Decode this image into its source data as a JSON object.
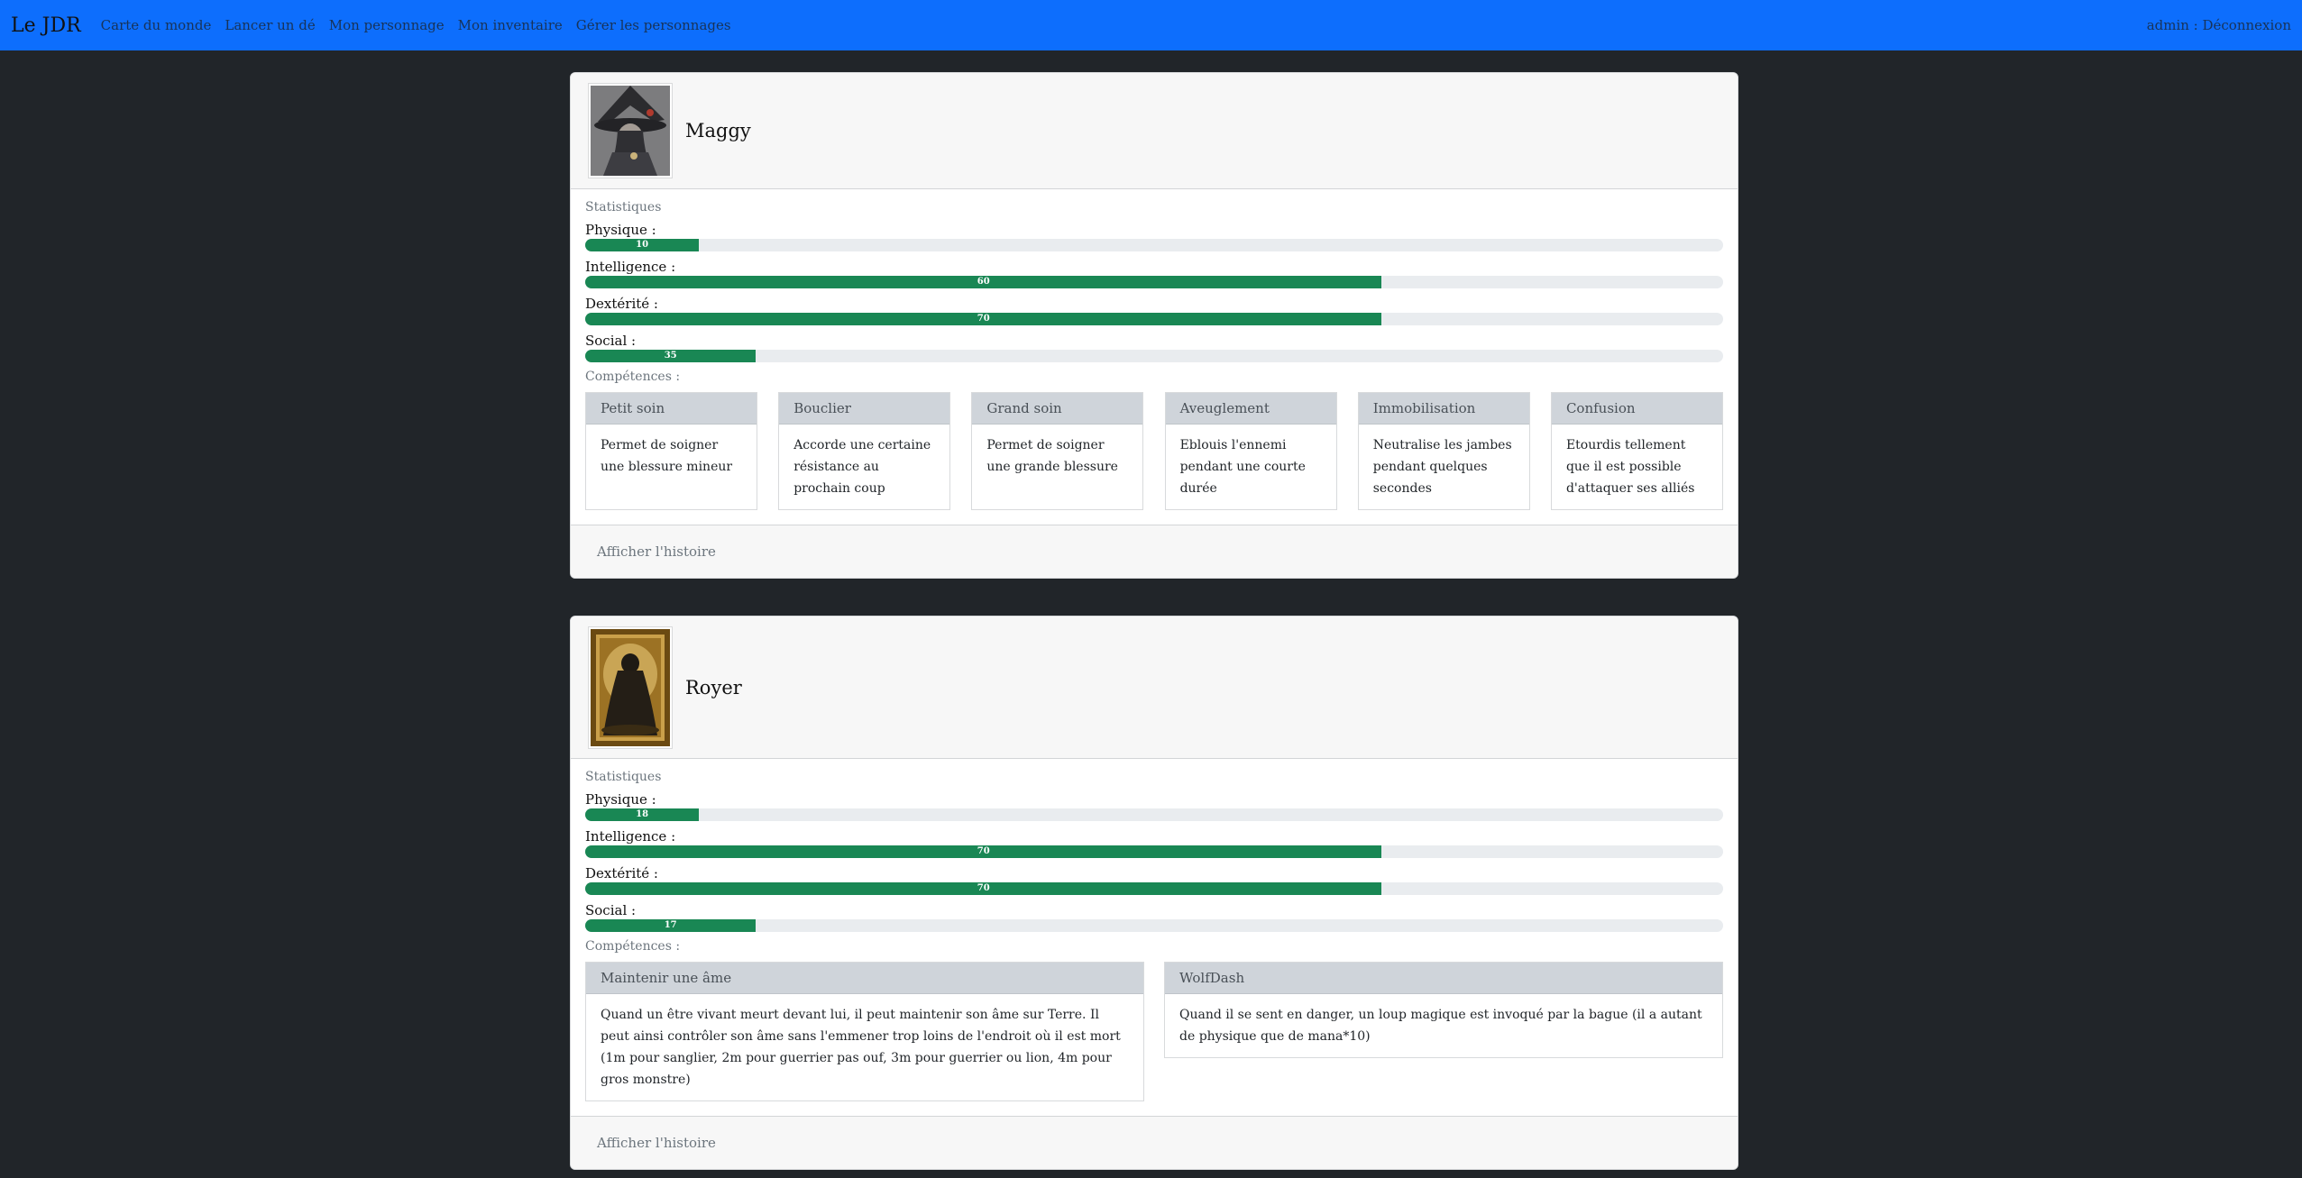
{
  "nav": {
    "brand": "Le JDR",
    "links": [
      "Carte du monde",
      "Lancer un dé",
      "Mon personnage",
      "Mon inventaire",
      "Gérer les personnages"
    ],
    "user": "admin : Déconnexion",
    "color": "#0d6efd"
  },
  "characters": [
    {
      "name": "Maggy",
      "stats_title": "Statistiques",
      "stats": [
        {
          "label": "Physique :",
          "value": "10",
          "fill": 0.1
        },
        {
          "label": "Intelligence :",
          "value": "60",
          "fill": 0.7
        },
        {
          "label": "Dextérité :",
          "value": "70",
          "fill": 0.7
        },
        {
          "label": "Social :",
          "value": "35",
          "fill": 0.15
        }
      ],
      "skills_title": "Compétences :",
      "skills": [
        {
          "title": "Petit soin",
          "text": "Permet de soigner une blessure mineur"
        },
        {
          "title": "Bouclier",
          "text": "Accorde une certaine résistance au prochain coup"
        },
        {
          "title": "Grand soin",
          "text": "Permet de soigner une grande blessure"
        },
        {
          "title": "Aveuglement",
          "text": "Eblouis l'ennemi pendant une courte durée"
        },
        {
          "title": "Immobilisation",
          "text": "Neutralise les jambes pendant quelques secondes"
        },
        {
          "title": "Confusion",
          "text": "Etourdis tellement que il est possible d'attaquer ses alliés"
        }
      ],
      "footer_link": "Afficher l'histoire"
    },
    {
      "name": "Royer",
      "stats_title": "Statistiques",
      "stats": [
        {
          "label": "Physique :",
          "value": "18",
          "fill": 0.1
        },
        {
          "label": "Intelligence :",
          "value": "70",
          "fill": 0.7
        },
        {
          "label": "Dextérité :",
          "value": "70",
          "fill": 0.7
        },
        {
          "label": "Social :",
          "value": "17",
          "fill": 0.15
        }
      ],
      "skills_title": "Compétences :",
      "skills": [
        {
          "title": "Maintenir une âme",
          "text": "Quand un être vivant meurt devant lui, il peut maintenir son âme sur Terre. Il peut ainsi contrôler son âme sans l'emmener trop loins de l'endroit où il est mort (1m pour sanglier, 2m pour guerrier pas ouf, 3m pour guerrier ou lion, 4m pour gros monstre)"
        },
        {
          "title": "WolfDash",
          "text": "Quand il se sent en danger, un loup magique est invoqué par la bague (il a autant de physique que de mana*10)"
        }
      ],
      "footer_link": "Afficher l'histoire"
    }
  ]
}
